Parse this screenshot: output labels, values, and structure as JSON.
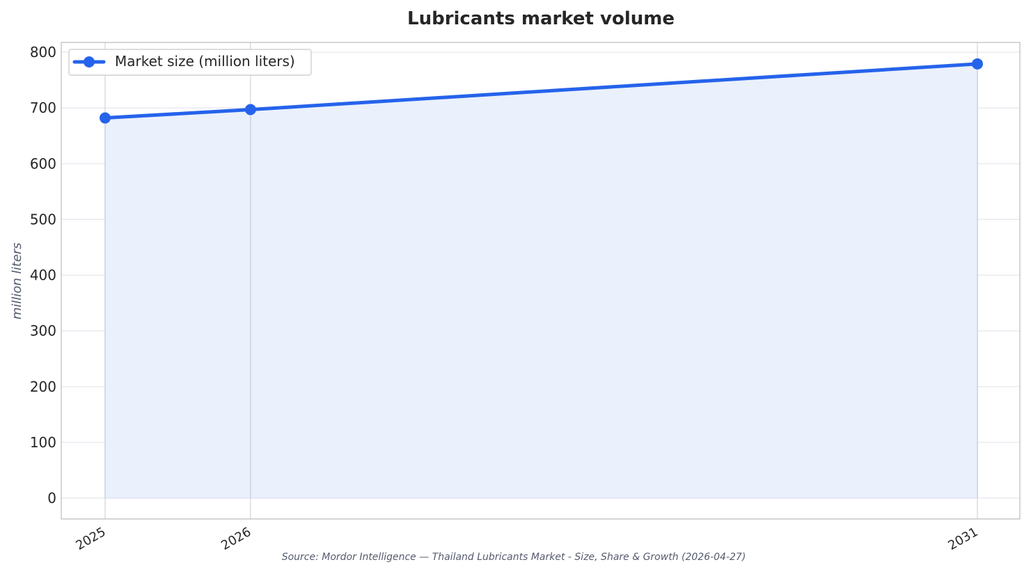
{
  "chart_data": {
    "type": "area",
    "title": "Lubricants market volume",
    "xlabel": "",
    "ylabel": "million liters",
    "categories": [
      "2025",
      "2026",
      "2031"
    ],
    "x": [
      2025,
      2026,
      2031
    ],
    "series": [
      {
        "name": "Market size (million liters)",
        "values": [
          682,
          697,
          779
        ]
      }
    ],
    "ylim": [
      0,
      800
    ],
    "yticks": [
      "0",
      "100",
      "200",
      "300",
      "400",
      "500",
      "600",
      "700",
      "800"
    ],
    "grid": true,
    "legend_position": "top-left",
    "source": "Source: Mordor Intelligence — Thailand Lubricants Market - Size, Share & Growth (2026-04-27)",
    "colors": {
      "line": "#2563eb",
      "fill": "#eaf0fc",
      "grid": "#e6e6ef",
      "frame": "#c8c8cc",
      "text": "#262626",
      "muted": "#555b6e"
    }
  }
}
